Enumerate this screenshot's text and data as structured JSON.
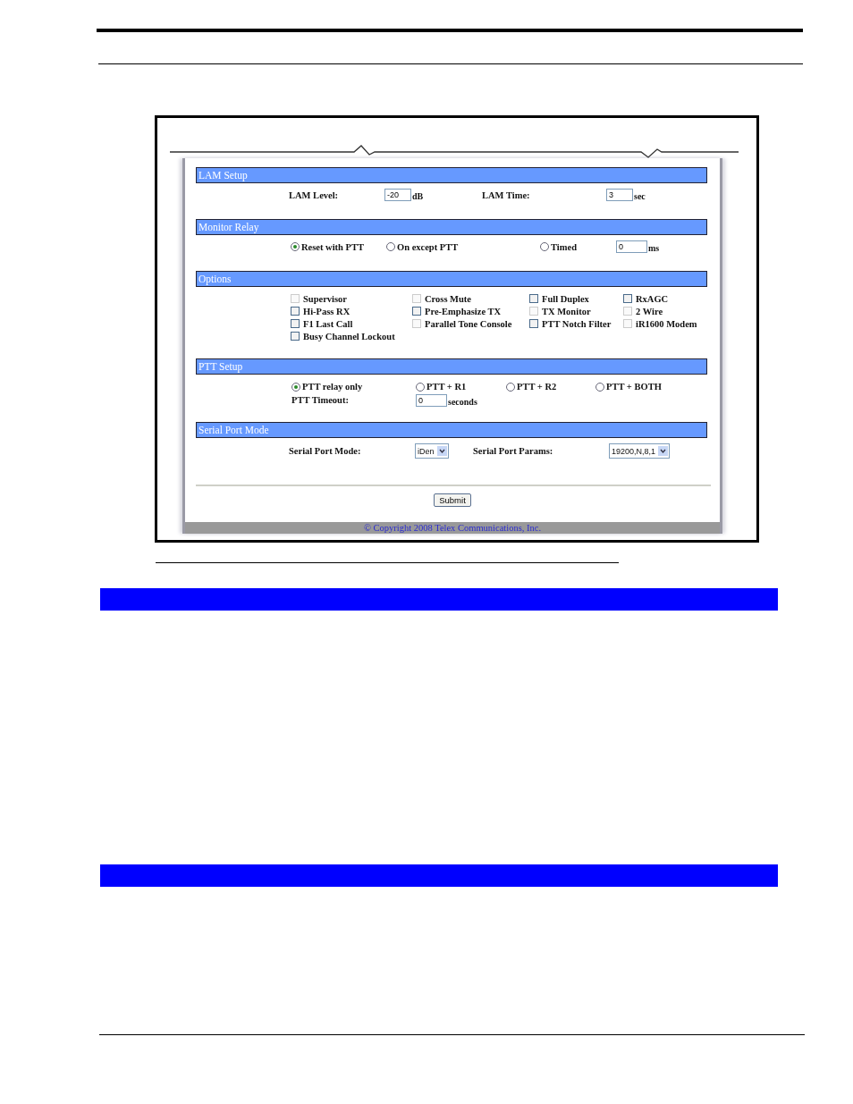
{
  "screenshot": {
    "sections": [
      {
        "kind": "fields",
        "title": "LAM Setup",
        "items": [
          {
            "label": "LAM Level:",
            "value": "-20",
            "unit": "dB"
          },
          {
            "label": "LAM Time:",
            "value": "3",
            "unit": "sec"
          }
        ]
      },
      {
        "kind": "radios",
        "title": "Monitor Relay",
        "options": [
          {
            "label": "Reset with PTT",
            "selected": true
          },
          {
            "label": "On except PTT",
            "selected": false
          },
          {
            "label": "Timed",
            "selected": false
          }
        ],
        "field": {
          "value": "0",
          "unit": "ms"
        }
      },
      {
        "kind": "checks",
        "title": "Options",
        "options": [
          {
            "label": "Supervisor",
            "checked": false,
            "disabled": true
          },
          {
            "label": "Cross Mute",
            "checked": false,
            "disabled": true
          },
          {
            "label": "Full Duplex",
            "checked": false,
            "disabled": false
          },
          {
            "label": "RxAGC",
            "checked": false,
            "disabled": false
          },
          {
            "label": "Hi-Pass RX",
            "checked": false,
            "disabled": false
          },
          {
            "label": "Pre-Emphasize TX",
            "checked": false,
            "disabled": false
          },
          {
            "label": "TX Monitor",
            "checked": false,
            "disabled": true
          },
          {
            "label": "2 Wire",
            "checked": false,
            "disabled": true
          },
          {
            "label": "F1 Last Call",
            "checked": false,
            "disabled": false
          },
          {
            "label": "Parallel Tone Console",
            "checked": false,
            "disabled": true
          },
          {
            "label": "PTT Notch Filter",
            "checked": false,
            "disabled": false
          },
          {
            "label": "iR1600 Modem",
            "checked": false,
            "disabled": true
          },
          {
            "label": "Busy Channel Lockout",
            "checked": false,
            "disabled": false
          }
        ]
      },
      {
        "kind": "ptt",
        "title": "PTT Setup",
        "options": [
          {
            "label": "PTT relay only",
            "selected": true
          },
          {
            "label": "PTT + R1",
            "selected": false
          },
          {
            "label": "PTT + R2",
            "selected": false
          },
          {
            "label": "PTT + BOTH",
            "selected": false
          }
        ],
        "timeout": {
          "label": "PTT Timeout:",
          "value": "0",
          "unit": "seconds"
        }
      },
      {
        "kind": "selects",
        "title": "Serial Port Mode",
        "items": [
          {
            "label": "Serial Port Mode:",
            "value": "iDen"
          },
          {
            "label": "Serial Port Params:",
            "value": "19200,N,8,1"
          }
        ]
      }
    ],
    "submit": "Submit",
    "copyright": "© Copyright 2008 Telex Communications, Inc."
  }
}
